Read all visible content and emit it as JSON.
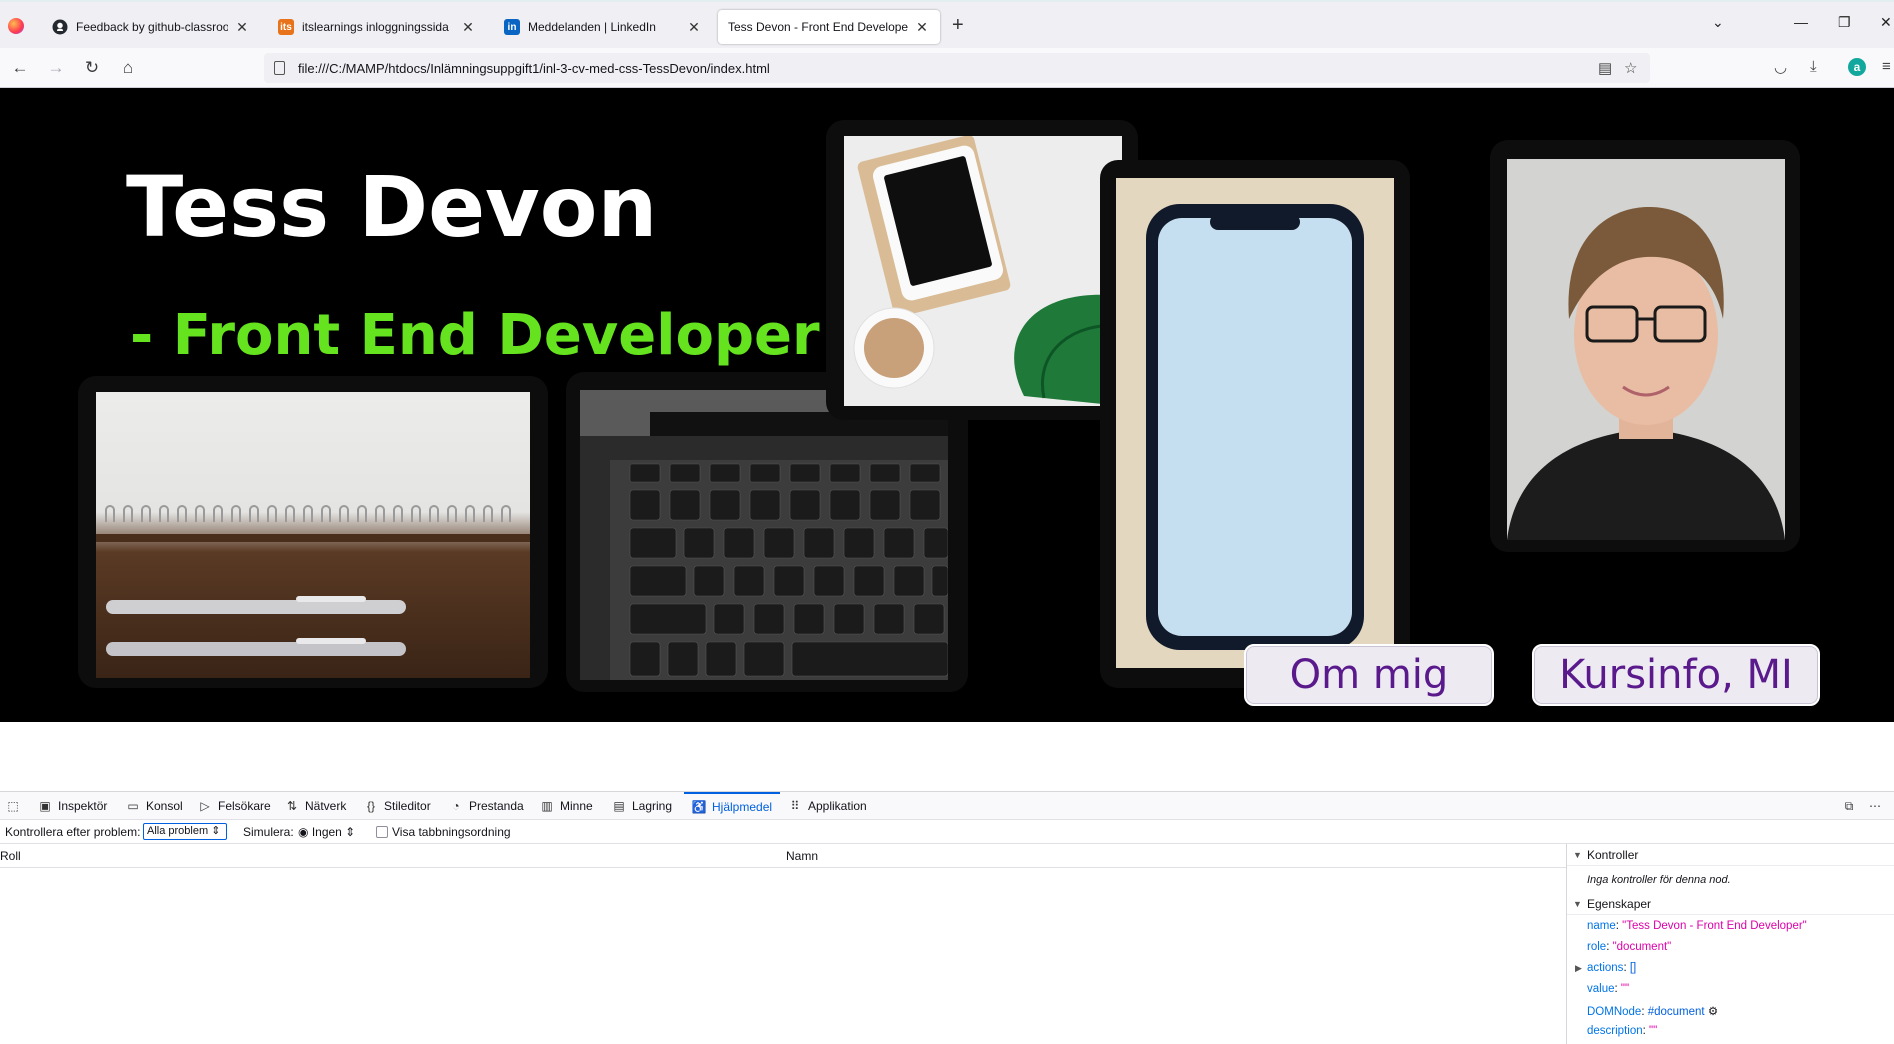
{
  "browser": {
    "tabs": [
      {
        "title": "Feedback by github-classroom[",
        "icon": "github-icon"
      },
      {
        "title": "itslearnings inloggningssida",
        "icon": "itslearning-icon"
      },
      {
        "title": "Meddelanden | LinkedIn",
        "icon": "linkedin-icon"
      },
      {
        "title": "Tess Devon - Front End Developer",
        "icon": "page-icon",
        "active": true
      }
    ],
    "url": "file:///C:/MAMP/htdocs/Inlämningsuppgift1/inl-3-cv-med-css-TessDevon/index.html",
    "account_initial": "a"
  },
  "page": {
    "name": "Tess Devon",
    "subtitle": "- Front End Developer",
    "subtitle_color": "#66e31f",
    "buttons": [
      "Om mig",
      "Kursinfo, MI"
    ],
    "button_text_color": "#5a1a8c"
  },
  "devtools": {
    "tabs": [
      "Inspektör",
      "Konsol",
      "Felsökare",
      "Nätverk",
      "Stileditor",
      "Prestanda",
      "Minne",
      "Lagring",
      "Hjälpmedel",
      "Applikation"
    ],
    "selected_tab": "Hjälpmedel",
    "toolbar": {
      "check_label": "Kontrollera efter problem:",
      "check_value": "Alla problem",
      "simulate_label": "Simulera:",
      "simulate_value": "Ingen",
      "tab_order_label": "Visa tabbningsordning"
    },
    "columns": [
      "Roll",
      "Namn"
    ],
    "sidebar": {
      "checks_title": "Kontroller",
      "checks_empty": "Inga kontroller för denna nod.",
      "props_title": "Egenskaper",
      "props": [
        {
          "key": "name",
          "value": "\"Tess Devon - Front End Developer\""
        },
        {
          "key": "role",
          "value": "\"document\""
        },
        {
          "key": "actions",
          "value": "[]"
        },
        {
          "key": "value",
          "value": "\"\""
        },
        {
          "key": "DOMNode",
          "value": "#document"
        },
        {
          "key": "description",
          "value": "\"\""
        }
      ]
    }
  }
}
